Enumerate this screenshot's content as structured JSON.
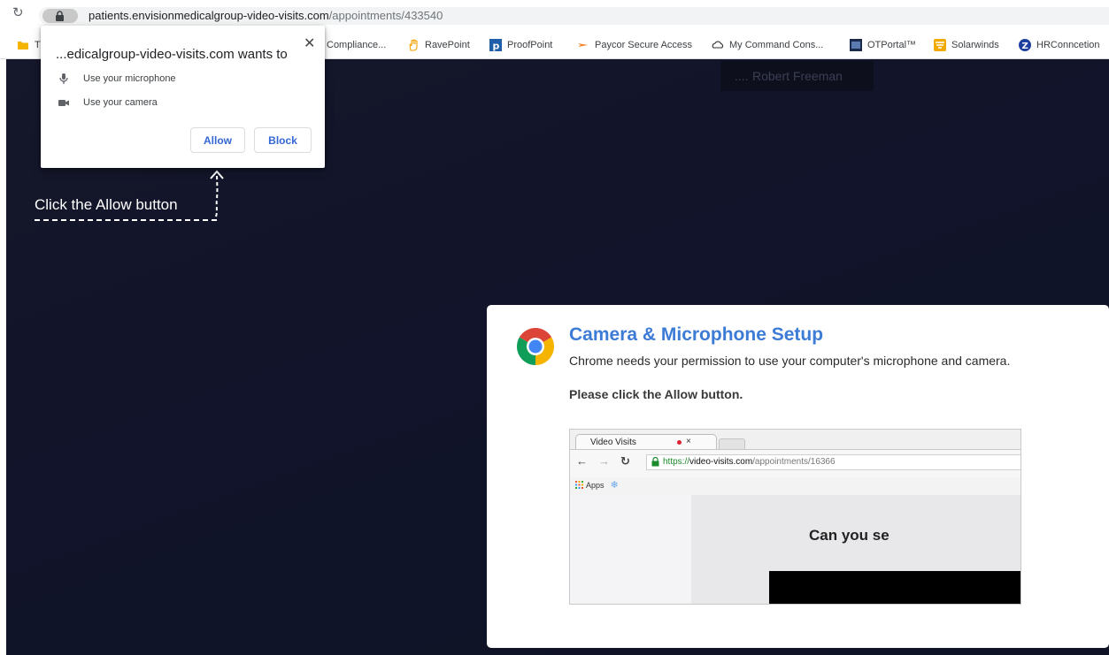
{
  "browser": {
    "url_host": "patients.envisionmedicalgroup-video-visits.com",
    "url_path": "/appointments/433540"
  },
  "bookmarks": [
    {
      "label": "T",
      "icon": "folder-icon"
    },
    {
      "label": "Compliance...",
      "icon": "page-icon"
    },
    {
      "label": "RavePoint",
      "icon": "hand-icon"
    },
    {
      "label": "ProofPoint",
      "icon": "proofpoint-icon"
    },
    {
      "label": "Paycor Secure Access",
      "icon": "paycor-icon"
    },
    {
      "label": "My Command Cons...",
      "icon": "cloud-icon"
    },
    {
      "label": "OTPortal™",
      "icon": "otportal-icon"
    },
    {
      "label": "Solarwinds",
      "icon": "solarwinds-icon"
    },
    {
      "label": "HRConncetion",
      "icon": "hrconnection-icon"
    }
  ],
  "permission_popup": {
    "title": "...edicalgroup-video-visits.com wants to",
    "items": [
      {
        "label": "Use your microphone",
        "icon": "microphone-icon"
      },
      {
        "label": "Use your camera",
        "icon": "camera-icon"
      }
    ],
    "allow_label": "Allow",
    "block_label": "Block"
  },
  "page": {
    "participant_name": "Robert Freeman",
    "participant_dots": "....",
    "hint_text": "Click the Allow button"
  },
  "setup": {
    "title": "Camera & Microphone Setup",
    "description": "Chrome needs your permission to use your computer's microphone and camera.",
    "instruction": "Please click the Allow button.",
    "example": {
      "tab_label": "Video Visits",
      "tab_close": "×",
      "url_scheme": "https://",
      "url_domain": "video-visits.com",
      "url_path": "/appointments/16366",
      "apps_label": "Apps",
      "content_text": "Can you se"
    }
  },
  "colors": {
    "page_background": "#13162a",
    "setup_title": "#3c7bd6",
    "popup_button_text": "#3367d6"
  }
}
